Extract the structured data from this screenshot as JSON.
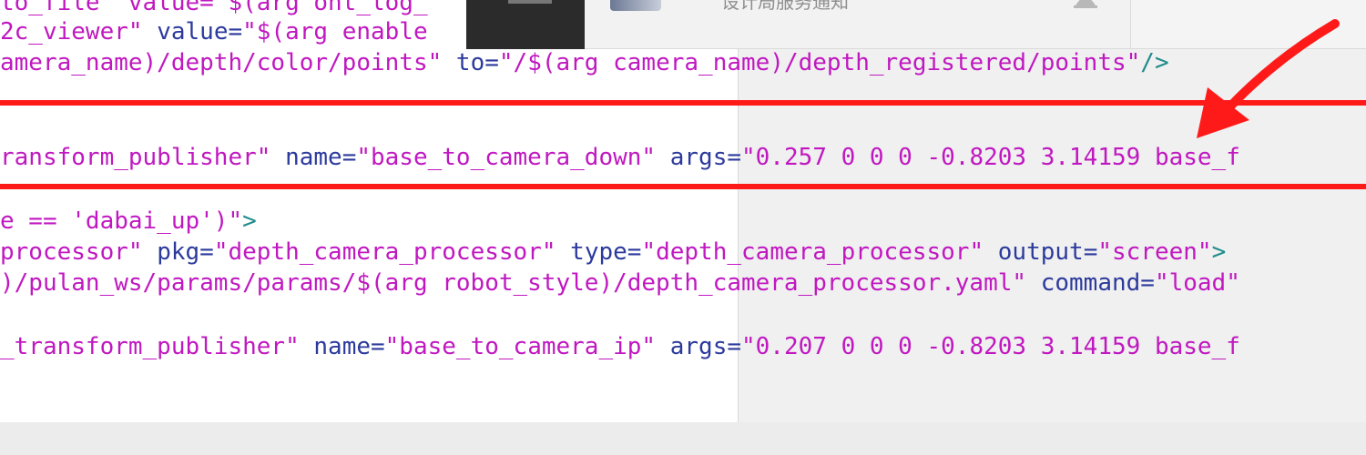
{
  "notification": {
    "text": "设计局服务通知"
  },
  "code_lines": [
    [
      {
        "text": "to_file\" value=\"$(arg ont_log_",
        "cls": "tok-magenta"
      }
    ],
    [
      {
        "text": "2c_viewer\"",
        "cls": "tok-magenta"
      },
      {
        "text": " value=",
        "cls": "tok-navy"
      },
      {
        "text": "\"$(arg enable",
        "cls": "tok-magenta"
      }
    ],
    [
      {
        "text": "amera_name)/depth/color/points\"",
        "cls": "tok-magenta"
      },
      {
        "text": " to=",
        "cls": "tok-navy"
      },
      {
        "text": "\"/$(arg camera_name)/depth_registered/points\"",
        "cls": "tok-magenta"
      },
      {
        "text": "/>",
        "cls": "tok-teal"
      }
    ],
    [
      {
        "text": "ransform_publisher\"",
        "cls": "tok-magenta"
      },
      {
        "text": " name=",
        "cls": "tok-navy"
      },
      {
        "text": "\"base_to_camera_down\"",
        "cls": "tok-magenta"
      },
      {
        "text": " args=",
        "cls": "tok-navy"
      },
      {
        "text": "\"0.257 0 0 0 -0.8203 3.14159 base_f",
        "cls": "tok-magenta"
      }
    ],
    [
      {
        "text": "e == 'dabai_up')\"",
        "cls": "tok-magenta"
      },
      {
        "text": ">",
        "cls": "tok-teal"
      }
    ],
    [
      {
        "text": "processor\"",
        "cls": "tok-magenta"
      },
      {
        "text": " pkg=",
        "cls": "tok-navy"
      },
      {
        "text": "\"depth_camera_processor\"",
        "cls": "tok-magenta"
      },
      {
        "text": " type=",
        "cls": "tok-navy"
      },
      {
        "text": "\"depth_camera_processor\"",
        "cls": "tok-magenta"
      },
      {
        "text": " output=",
        "cls": "tok-navy"
      },
      {
        "text": "\"screen\"",
        "cls": "tok-magenta"
      },
      {
        "text": ">",
        "cls": "tok-teal"
      }
    ],
    [
      {
        "text": ")/pulan_ws/params/params/$(arg robot_style)/depth_camera_processor.yaml\"",
        "cls": "tok-magenta"
      },
      {
        "text": " command=",
        "cls": "tok-navy"
      },
      {
        "text": "\"load\"",
        "cls": "tok-magenta"
      }
    ],
    [
      {
        "text": "_transform_publisher\"",
        "cls": "tok-magenta"
      },
      {
        "text": " name=",
        "cls": "tok-navy"
      },
      {
        "text": "\"base_to_camera_ip\"",
        "cls": "tok-magenta"
      },
      {
        "text": " args=",
        "cls": "tok-navy"
      },
      {
        "text": "\"0.207 0 0 0 -0.8203 3.14159 base_f",
        "cls": "tok-magenta"
      }
    ]
  ],
  "annotation": {
    "arrow_color": "#ff1a1a",
    "highlight_color": "#ff1a1a"
  }
}
